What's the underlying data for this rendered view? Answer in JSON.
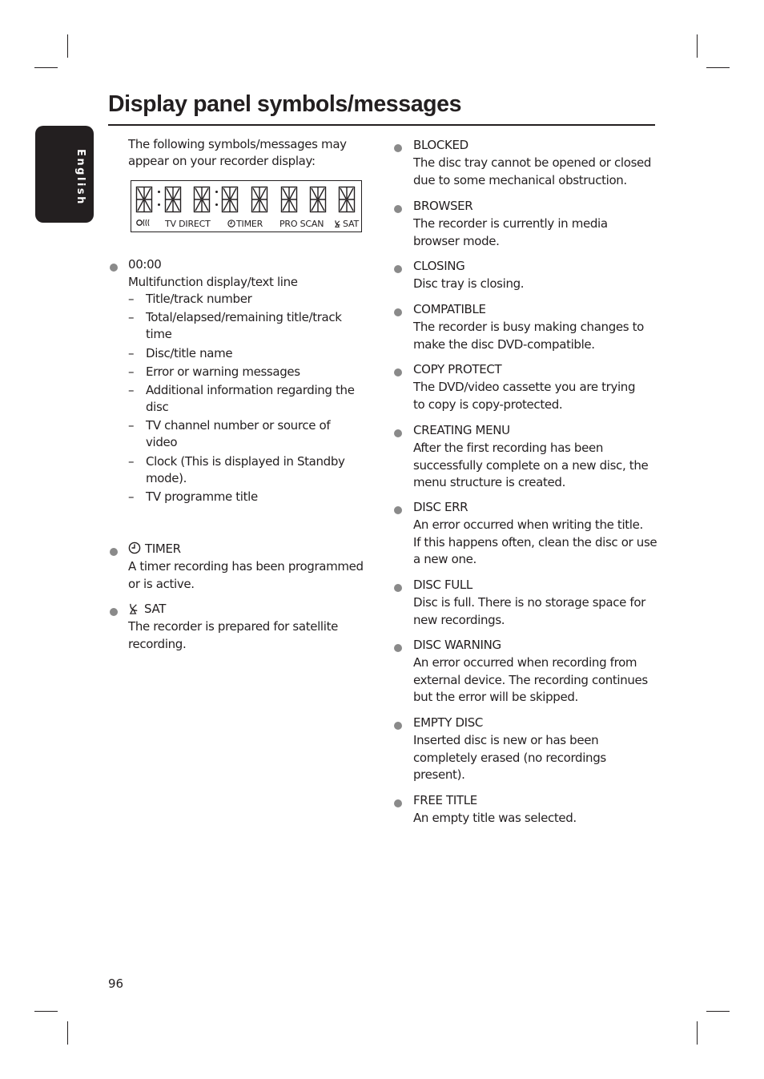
{
  "page": {
    "title": "Display panel symbols/messages",
    "language_tab": "English",
    "page_number": "96"
  },
  "intro": {
    "lines": [
      "The following symbols/messages may",
      "appear on your recorder display:"
    ]
  },
  "lcd_display": {
    "indicators": [
      {
        "icon": "remote-signal-icon",
        "label": "O(("
      },
      {
        "icon": "",
        "label": "TV DIRECT"
      },
      {
        "icon": "clock-icon",
        "label": "TIMER"
      },
      {
        "icon": "",
        "label": "PRO SCAN"
      },
      {
        "icon": "satellite-dish-icon",
        "label": "SAT"
      }
    ]
  },
  "left_items": [
    {
      "heading": "00:00",
      "icon": "",
      "description": [
        "Multifunction display/text line"
      ],
      "subitems": [
        [
          "Title/track number"
        ],
        [
          "Total/elapsed/remaining title/track",
          "time"
        ],
        [
          "Disc/title name"
        ],
        [
          "Error or warning messages"
        ],
        [
          "Additional information regarding the",
          "disc"
        ],
        [
          "TV channel number or source of",
          "video"
        ],
        [
          "Clock (This is displayed in Standby",
          "mode)."
        ],
        [
          "TV programme title"
        ]
      ]
    },
    {
      "heading": "TIMER",
      "icon": "clock-icon",
      "description": [
        "A timer recording has been programmed",
        "or is active."
      ]
    },
    {
      "heading": "SAT",
      "icon": "satellite-dish-icon",
      "description": [
        "The recorder is prepared for satellite",
        "recording."
      ]
    }
  ],
  "right_items": [
    {
      "heading": "BLOCKED",
      "description": [
        "The disc tray cannot be opened or closed",
        "due to some mechanical obstruction."
      ]
    },
    {
      "heading": "BROWSER",
      "description": [
        "The recorder is currently in media",
        "browser mode."
      ]
    },
    {
      "heading": "CLOSING",
      "description": [
        "Disc tray is closing."
      ]
    },
    {
      "heading": "COMPATIBLE",
      "description": [
        "The recorder is busy making changes to",
        "make the disc DVD-compatible."
      ]
    },
    {
      "heading": "COPY PROTECT",
      "description": [
        "The DVD/video cassette you are trying",
        "to copy is copy-protected."
      ]
    },
    {
      "heading": "CREATING MENU",
      "description": [
        "After the first recording has been",
        "successfully complete on a new disc, the",
        "menu structure is created."
      ]
    },
    {
      "heading": "DISC ERR",
      "description": [
        "An error occurred when writing the title.",
        "If this happens often, clean the disc or use",
        "a new one."
      ]
    },
    {
      "heading": "DISC FULL",
      "description": [
        "Disc is full. There is no storage space for",
        "new recordings."
      ]
    },
    {
      "heading": "DISC WARNING",
      "description": [
        "An error occurred when recording from",
        "external device. The recording continues",
        "but the error will be skipped."
      ]
    },
    {
      "heading": "EMPTY DISC",
      "description": [
        "Inserted disc is new or has been",
        "completely erased (no recordings",
        "present)."
      ]
    },
    {
      "heading": "FREE TITLE",
      "description": [
        "An empty title was selected."
      ]
    }
  ]
}
